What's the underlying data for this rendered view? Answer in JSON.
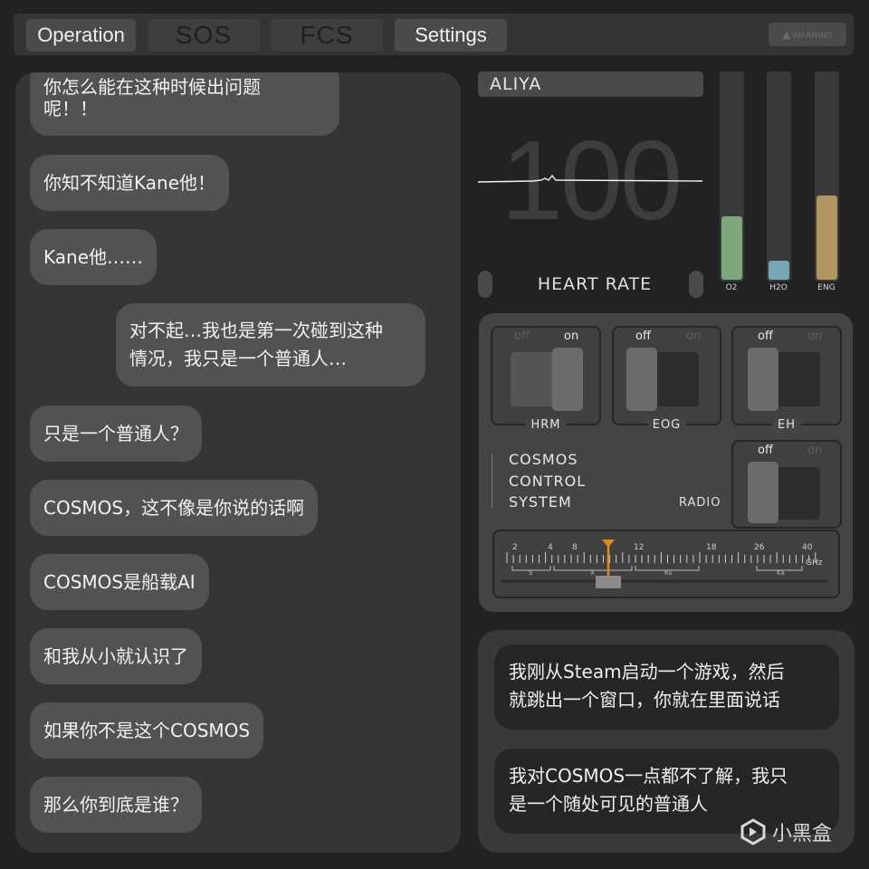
{
  "nav": {
    "tabs": [
      {
        "label": "Operation",
        "state": "active"
      },
      {
        "label": "SOS",
        "state": "disabled"
      },
      {
        "label": "FCS",
        "state": "disabled"
      },
      {
        "label": "Settings",
        "state": "active"
      }
    ],
    "warning": {
      "label": "WARNING",
      "icon": "warning-icon"
    }
  },
  "chat": {
    "messages": [
      {
        "text": "你怎么能在这种时候出问题呢！！",
        "side": "left"
      },
      {
        "text": "你知不知道Kane他！",
        "side": "left"
      },
      {
        "text": "Kane他……",
        "side": "left"
      },
      {
        "text": "对不起…我也是第一次碰到这种情况，我只是一个普通人…",
        "side": "right"
      },
      {
        "text": "只是一个普通人？",
        "side": "left"
      },
      {
        "text": "COSMOS，这不像是你说的话啊",
        "side": "left"
      },
      {
        "text": "COSMOS是船载AI",
        "side": "left"
      },
      {
        "text": "和我从小就认识了",
        "side": "left"
      },
      {
        "text": "如果你不是这个COSMOS",
        "side": "left"
      },
      {
        "text": "那么你到底是谁？",
        "side": "left"
      }
    ],
    "first_line_partial": "你怎么能在这种时候出问题",
    "first_line_rest": "呢！！",
    "right_line1": "对不起…我也是第一次碰到这种",
    "right_line2": "情况，我只是一个普通人…"
  },
  "vitals": {
    "name": "ALIYA",
    "heart_rate_value": "100",
    "heart_rate_label": "HEART RATE",
    "gauges": [
      {
        "label": "O2",
        "level": 0.3,
        "color": "#7fa77c"
      },
      {
        "label": "H2O",
        "level": 0.09,
        "color": "#76a5b4"
      },
      {
        "label": "ENG",
        "level": 0.4,
        "color": "#b19560"
      }
    ]
  },
  "controls": {
    "off_label": "off",
    "on_label": "on",
    "switches": [
      {
        "name": "HRM",
        "state": "on"
      },
      {
        "name": "EOG",
        "state": "off"
      },
      {
        "name": "EH",
        "state": "off"
      },
      {
        "name": "RADIO",
        "state": "off"
      }
    ],
    "system_lines": [
      "COSMOS",
      "CONTROL",
      "SYSTEM"
    ],
    "radio_label": "RADIO",
    "dial": {
      "ticks": [
        "2",
        "4",
        "8",
        "12",
        "18",
        "26",
        "40"
      ],
      "bands": [
        "S",
        "X",
        "Ku",
        "Ka"
      ],
      "unit": "GHz",
      "accent": "#e08a1e"
    }
  },
  "messages": [
    {
      "line1": "我刚从Steam启动一个游戏，然后",
      "line2": "就跳出一个窗口，你就在里面说话"
    },
    {
      "line1": "我对COSMOS一点都不了解，我只",
      "line2": "是一个随处可见的普通人"
    }
  ],
  "watermark": {
    "text": "小黑盒"
  }
}
